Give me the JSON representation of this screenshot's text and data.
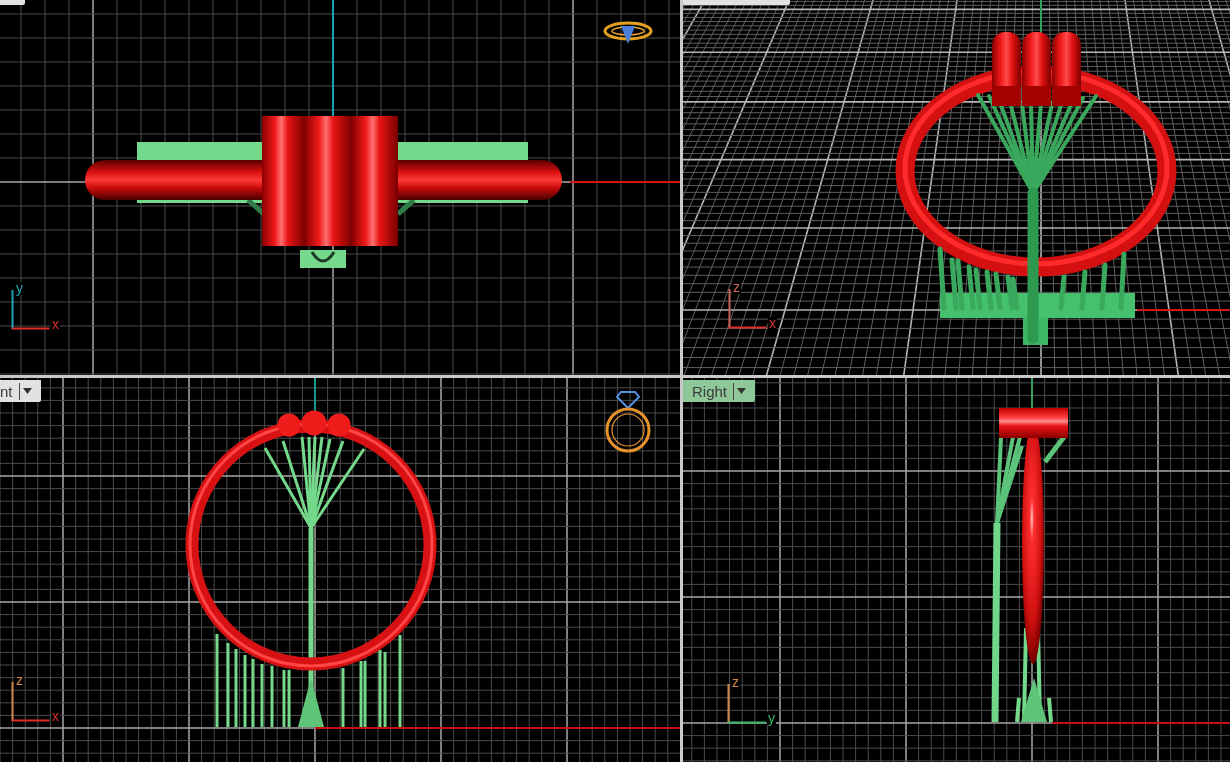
{
  "viewports": [
    {
      "kind": "top",
      "tab": {
        "selected": false
      },
      "ring_icon": true,
      "axes": [
        {
          "kind": "vertical",
          "label": "y",
          "color": "#1fa5b8"
        },
        {
          "kind": "horizontal",
          "label": "x",
          "color": "#d83030"
        }
      ]
    },
    {
      "kind": "perspective",
      "tab": {
        "selected": false
      },
      "axes": [
        {
          "kind": "vertical",
          "label": "z",
          "color": "#c8645a"
        },
        {
          "kind": "horizontal",
          "label": "x",
          "color": "#d83030"
        }
      ]
    },
    {
      "kind": "front",
      "tab": {
        "label": "nt",
        "selected": false
      },
      "ring_icon": true,
      "axes": [
        {
          "kind": "vertical",
          "label": "z",
          "color": "#d08a4a"
        },
        {
          "kind": "horizontal",
          "label": "x",
          "color": "#d83030"
        }
      ]
    },
    {
      "kind": "right",
      "tab": {
        "label": "Right",
        "selected": true
      },
      "axes": [
        {
          "kind": "vertical",
          "label": "z",
          "color": "#d08a4a"
        },
        {
          "kind": "horizontal",
          "label": "y",
          "color": "#3cb868"
        }
      ]
    }
  ]
}
